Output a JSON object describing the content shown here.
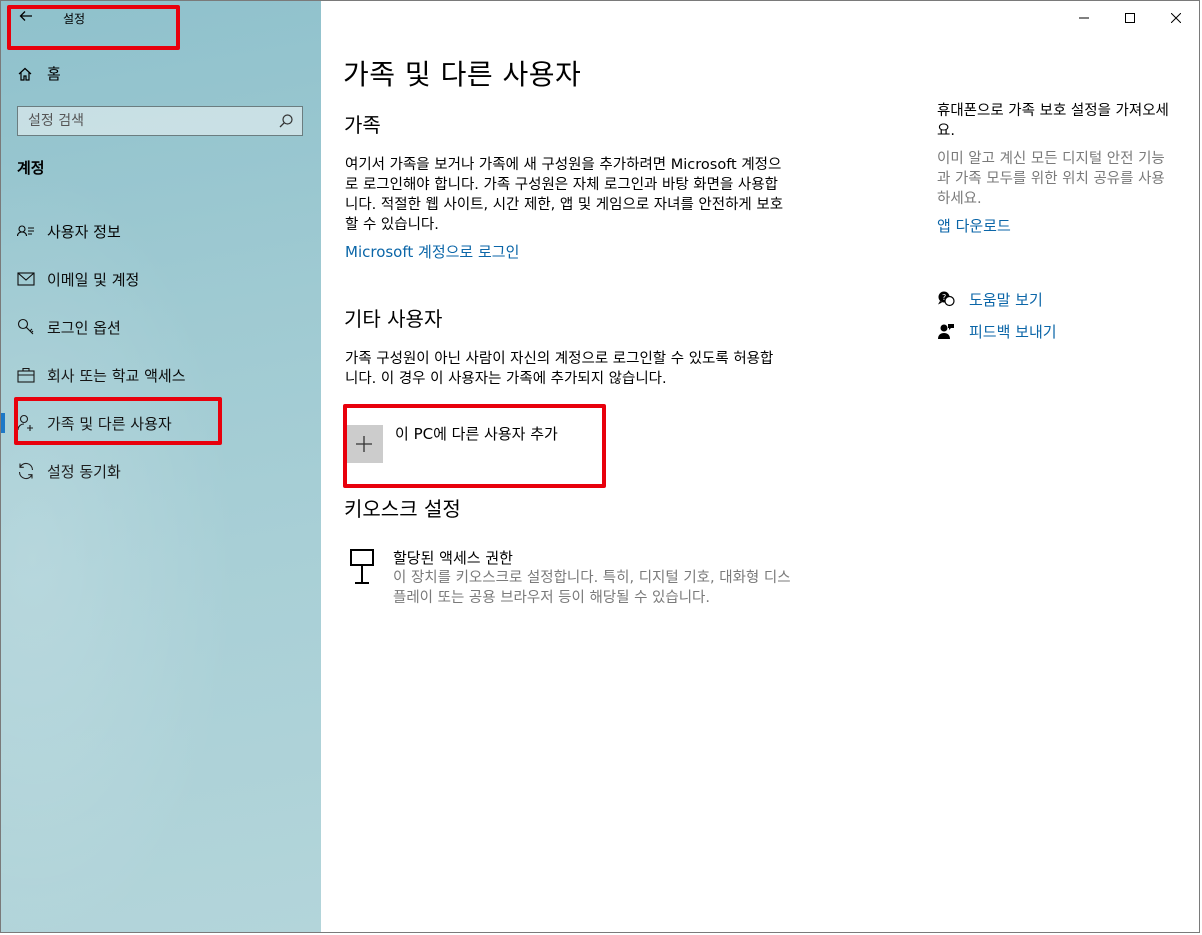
{
  "app": {
    "title": "설정",
    "back_icon": "back-arrow-icon"
  },
  "sidebar": {
    "home_label": "홈",
    "search_placeholder": "설정 검색",
    "section": "계정",
    "items": [
      {
        "label": "사용자 정보",
        "icon": "person-card-icon"
      },
      {
        "label": "이메일 및 계정",
        "icon": "mail-icon"
      },
      {
        "label": "로그인 옵션",
        "icon": "key-icon"
      },
      {
        "label": "회사 또는 학교 액세스",
        "icon": "briefcase-icon"
      },
      {
        "label": "가족 및 다른 사용자",
        "icon": "person-add-icon",
        "active": true
      },
      {
        "label": "설정 동기화",
        "icon": "sync-icon"
      }
    ]
  },
  "window_controls": {
    "minimize": "—",
    "maximize": "☐",
    "close": "✕"
  },
  "main": {
    "title": "가족 및 다른 사용자",
    "family": {
      "heading": "가족",
      "description": "여기서 가족을 보거나 가족에 새 구성원을 추가하려면 Microsoft 계정으로 로그인해야 합니다. 가족 구성원은 자체 로그인과 바탕 화면을 사용합니다. 적절한 웹 사이트, 시간 제한, 앱 및 게임으로 자녀를 안전하게 보호할 수 있습니다.",
      "link": "Microsoft 계정으로 로그인"
    },
    "other_users": {
      "heading": "기타 사용자",
      "description": "가족 구성원이 아닌 사람이 자신의 계정으로 로그인할 수 있도록 허용합니다. 이 경우 이 사용자는 가족에 추가되지 않습니다.",
      "add_label": "이 PC에 다른 사용자 추가",
      "add_icon": "plus-icon"
    },
    "kiosk": {
      "heading": "키오스크 설정",
      "title": "할당된 액세스 권한",
      "description": "이 장치를 키오스크로 설정합니다. 특히, 디지털 기호, 대화형 디스플레이 또는 공용 브라우저 등이 해당될 수 있습니다.",
      "icon": "kiosk-icon"
    }
  },
  "side_panel": {
    "title": "휴대폰으로 가족 보호 설정을 가져오세요.",
    "description": "이미 알고 계신 모든 디지털 안전 기능과 가족 모두를 위한 위치 공유를 사용하세요.",
    "link": "앱 다운로드",
    "help_label": "도움말 보기",
    "feedback_label": "피드백 보내기"
  },
  "colors": {
    "accent": "#0067c0",
    "link": "#0b66a8",
    "highlight": "#e8000c"
  }
}
